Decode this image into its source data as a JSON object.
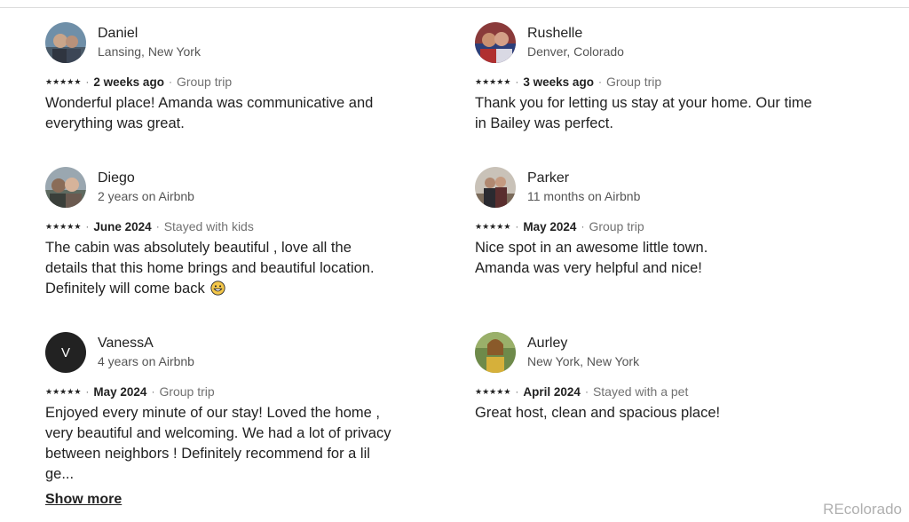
{
  "reviews": [
    {
      "name": "Daniel",
      "subtitle": "Lansing, New York",
      "stars": 5,
      "date": "2 weeks ago",
      "trip": "Group trip",
      "text": "Wonderful place! Amanda was communicative and everything was great.",
      "avatar": "photo"
    },
    {
      "name": "Rushelle",
      "subtitle": "Denver, Colorado",
      "stars": 5,
      "date": "3 weeks ago",
      "trip": "Group trip",
      "text": "Thank you for letting us stay at your home. Our time in Bailey was perfect.",
      "avatar": "photo"
    },
    {
      "name": "Diego",
      "subtitle": "2 years on Airbnb",
      "stars": 5,
      "date": "June 2024",
      "trip": "Stayed with kids",
      "text": "The cabin was absolutely beautiful , love all the details that this home brings and beautiful location. Definitely will come back",
      "avatar": "photo",
      "emoji": "grinning-face-emoji"
    },
    {
      "name": "Parker",
      "subtitle": "11 months on Airbnb",
      "stars": 5,
      "date": "May 2024",
      "trip": "Group trip",
      "text": "Nice spot in an awesome little town.\nAmanda was very helpful and nice!",
      "avatar": "photo"
    },
    {
      "name": "VanessA",
      "subtitle": "4 years on Airbnb",
      "stars": 5,
      "date": "May 2024",
      "trip": "Group trip",
      "text": "Enjoyed every minute of our stay! Loved the home , very beautiful and welcoming. We had a lot of privacy between neighbors ! Definitely recommend for a lil ge...",
      "avatar": "initial",
      "avatar_initial": "V",
      "show_more": "Show more"
    },
    {
      "name": "Aurley",
      "subtitle": "New York, New York",
      "stars": 5,
      "date": "April 2024",
      "trip": "Stayed with a pet",
      "text": "Great host, clean and spacious place!",
      "avatar": "photo"
    }
  ],
  "star_icon": "star-icon",
  "separator": "·",
  "watermark": "REcolorado",
  "colors": {
    "text": "#222222",
    "muted": "#717171",
    "subtitle": "#555555",
    "watermark": "#b0b0b0",
    "avatar_initial_bg": "#222222"
  }
}
